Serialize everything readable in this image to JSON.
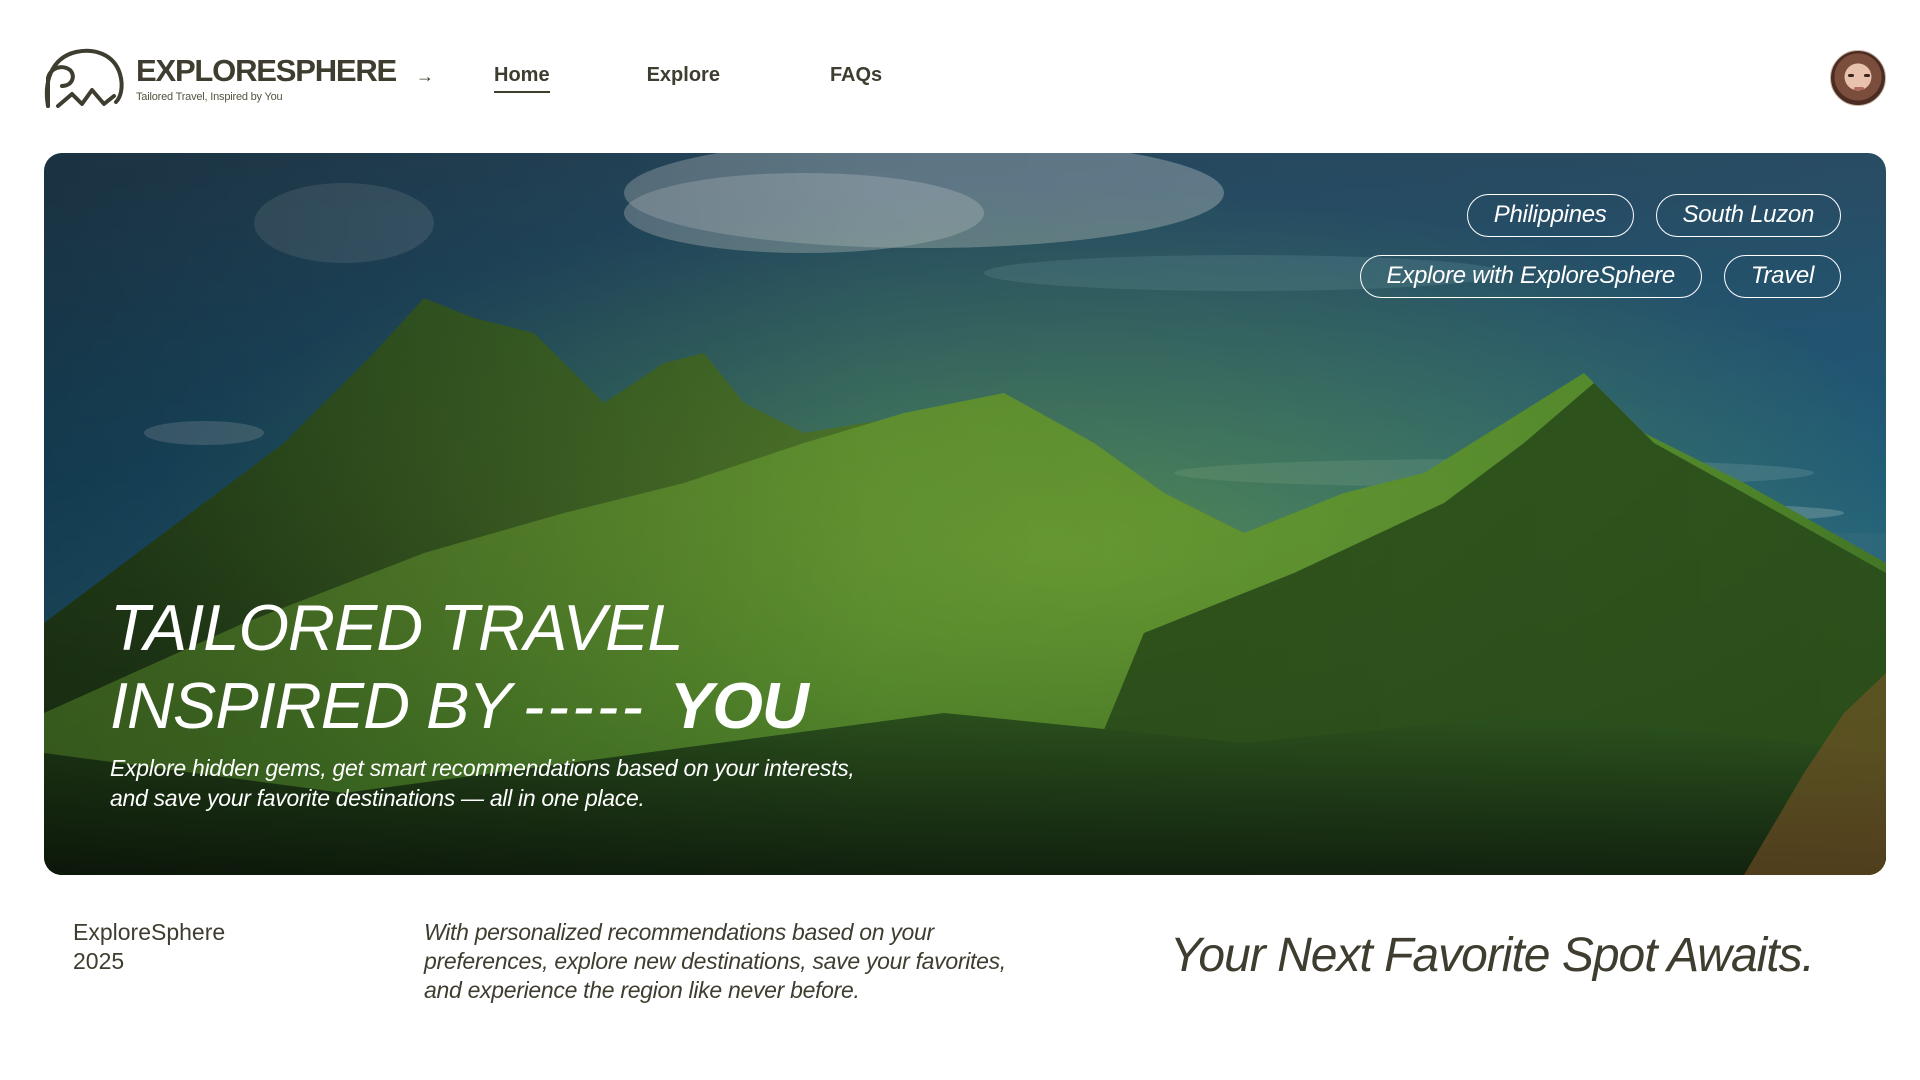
{
  "brand": {
    "name": "EXPLORESPHERE",
    "tagline": "Tailored Travel, Inspired by You"
  },
  "nav": {
    "arrow_icon": "arrow-right-icon",
    "items": [
      {
        "label": "Home",
        "active": true
      },
      {
        "label": "Explore",
        "active": false
      },
      {
        "label": "FAQs",
        "active": false
      }
    ]
  },
  "user": {
    "avatar_icon": "user-avatar"
  },
  "hero": {
    "tags_row1": [
      "Philippines",
      "South Luzon"
    ],
    "tags_row2": [
      "Explore with ExploreSphere",
      "Travel"
    ],
    "headline_line1": "TAILORED TRAVEL",
    "headline_line2": "INSPIRED BY",
    "headline_dash": "-----",
    "headline_emphasis": "YOU",
    "description": "Explore hidden gems, get smart recommendations based on your interests, and save your favorite destinations — all in one place."
  },
  "footer": {
    "brand_name": "ExploreSphere",
    "year": "2025",
    "description": "With personalized recommendations based on your preferences, explore new destinations, save your favorites, and experience the region like never before.",
    "cta": "Your Next Favorite Spot Awaits."
  },
  "colors": {
    "text_dark": "#3f3d2f",
    "sky": "#1f5a78",
    "mountain_green": "#4f8a2c",
    "white": "#ffffff"
  }
}
